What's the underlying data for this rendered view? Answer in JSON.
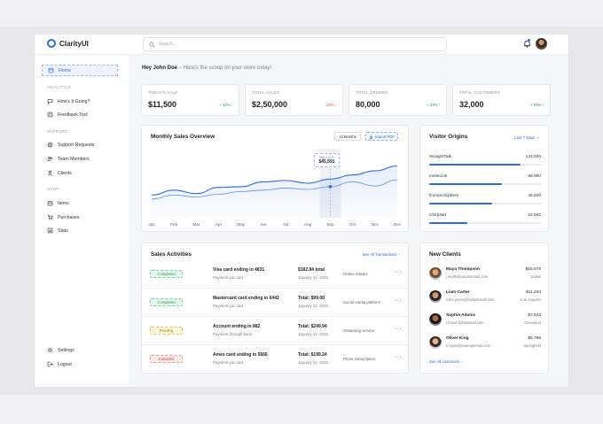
{
  "app": {
    "name": "ClarityUI"
  },
  "search": {
    "placeholder": "Search..."
  },
  "colors": {
    "accent": "#2b6be3",
    "positive": "#1f9d55",
    "negative": "#e0413a"
  },
  "sidebar": {
    "home": "Home",
    "sections": {
      "analytics": "ANALYTICS",
      "support": "SUPPORT",
      "shop": "SHOP"
    },
    "items": {
      "hows_it_going": "How's It Going?",
      "feedback_tool": "Feedback Tool",
      "support_requests": "Support Requests",
      "team_members": "Team Members",
      "clients": "Clients",
      "items": "Items",
      "purchases": "Purchases",
      "stats": "Stats",
      "settings": "Settings",
      "logout": "Logout"
    },
    "icons": [
      "home-icon",
      "chat-icon",
      "feedback-icon",
      "support-icon",
      "team-icon",
      "clients-icon",
      "box-icon",
      "cart-icon",
      "stats-icon",
      "settings-icon",
      "logout-icon"
    ]
  },
  "greeting": {
    "name": "Hey John Doe",
    "sep": " – ",
    "subtitle": "Here's the scoop on your store today!"
  },
  "stats": [
    {
      "label": "TODAY'S SALE",
      "value": "$11,500",
      "change": "+ 42% ↑",
      "direction": "up"
    },
    {
      "label": "TOTAL SALES",
      "value": "$2,50,000",
      "change": "- 15% ↓",
      "direction": "down"
    },
    {
      "label": "TOTAL ORDERS",
      "value": "80,000",
      "change": "+ 33% ↑",
      "direction": "up"
    },
    {
      "label": "TOTAL CUSTOMERS",
      "value": "32,000",
      "change": "+ 29% ↑",
      "direction": "up"
    }
  ],
  "sales_overview": {
    "title": "Monthly Sales Overview",
    "range_button": "12 Months",
    "export_button": "Export PDF",
    "tooltip": {
      "date": "Sep 2025",
      "value": "$45,591"
    }
  },
  "chart_data": {
    "type": "line",
    "title": "Monthly Sales Overview",
    "categories": [
      "Jan",
      "Feb",
      "Mar",
      "Apr",
      "May",
      "Jun",
      "Jul",
      "Aug",
      "Sep",
      "Oct",
      "Nov",
      "Dec"
    ],
    "series": [
      {
        "values": [
          33,
          40,
          35,
          44,
          45,
          52,
          54,
          50,
          56,
          62,
          68,
          75
        ]
      },
      {
        "values": [
          27,
          33,
          30,
          34,
          38,
          40,
          43,
          41,
          45,
          52,
          46,
          55
        ]
      }
    ],
    "ylim": [
      0,
      100
    ],
    "grid": false,
    "highlight": {
      "category": "Sep",
      "label": "$45,591"
    }
  },
  "visitor_origins": {
    "title": "Visitor Origins",
    "range": "Last 7 Days",
    "items": [
      {
        "name": "StraightTalk",
        "value": "143,500",
        "fraction": 0.82
      },
      {
        "name": "InviteLink",
        "value": "88,000",
        "fraction": 0.65
      },
      {
        "name": "ConnectSphere",
        "value": "45,500",
        "fraction": 0.56
      },
      {
        "name": "ChirpNet",
        "value": "22,000",
        "fraction": 0.34
      }
    ]
  },
  "sales_activities": {
    "title": "Sales Activities",
    "link": "See All Transactions",
    "rows": [
      {
        "status": "Completed",
        "status_kind": "completed",
        "title": "Visa card ending in 4831",
        "subtitle": "Payment via card",
        "total": "$182.94 total",
        "date": "January 17, 2025",
        "type": "Online retailer"
      },
      {
        "status": "Completed",
        "status_kind": "completed",
        "title": "Mastercard card ending in 6442",
        "subtitle": "Payment via card",
        "total": "Total: $99.00",
        "date": "January 17, 2025",
        "type": "Social media platform"
      },
      {
        "status": "Pending",
        "status_kind": "pending",
        "title": "Account ending in 882",
        "subtitle": "Payment through bank",
        "total": "Total: $249.94",
        "date": "January 17, 2025",
        "type": "Streaming service"
      },
      {
        "status": "Canceled",
        "status_kind": "canceled",
        "title": "Amex card ending in 5666",
        "subtitle": "Payment via card",
        "total": "Total: $199.24",
        "date": "January 17, 2025",
        "type": "Prime subscription"
      }
    ]
  },
  "new_clients": {
    "title": "New Clients",
    "link": "See All customers",
    "rows": [
      {
        "name": "Maya Thompson",
        "email": "j.smith@randommail.com",
        "amount": "$15,678",
        "city": "Dallas"
      },
      {
        "name": "Liam Carter",
        "email": "mike.jones@samplemail.com",
        "amount": "$11,234",
        "city": "Los Angeles"
      },
      {
        "name": "Sophie Adams",
        "email": "t.brown@fakemail.com",
        "amount": "$7,543",
        "city": "Cleveland"
      },
      {
        "name": "Oliver King",
        "email": "k.lopez@examplemail.com",
        "amount": "$6,789",
        "city": "Springfield"
      }
    ]
  }
}
